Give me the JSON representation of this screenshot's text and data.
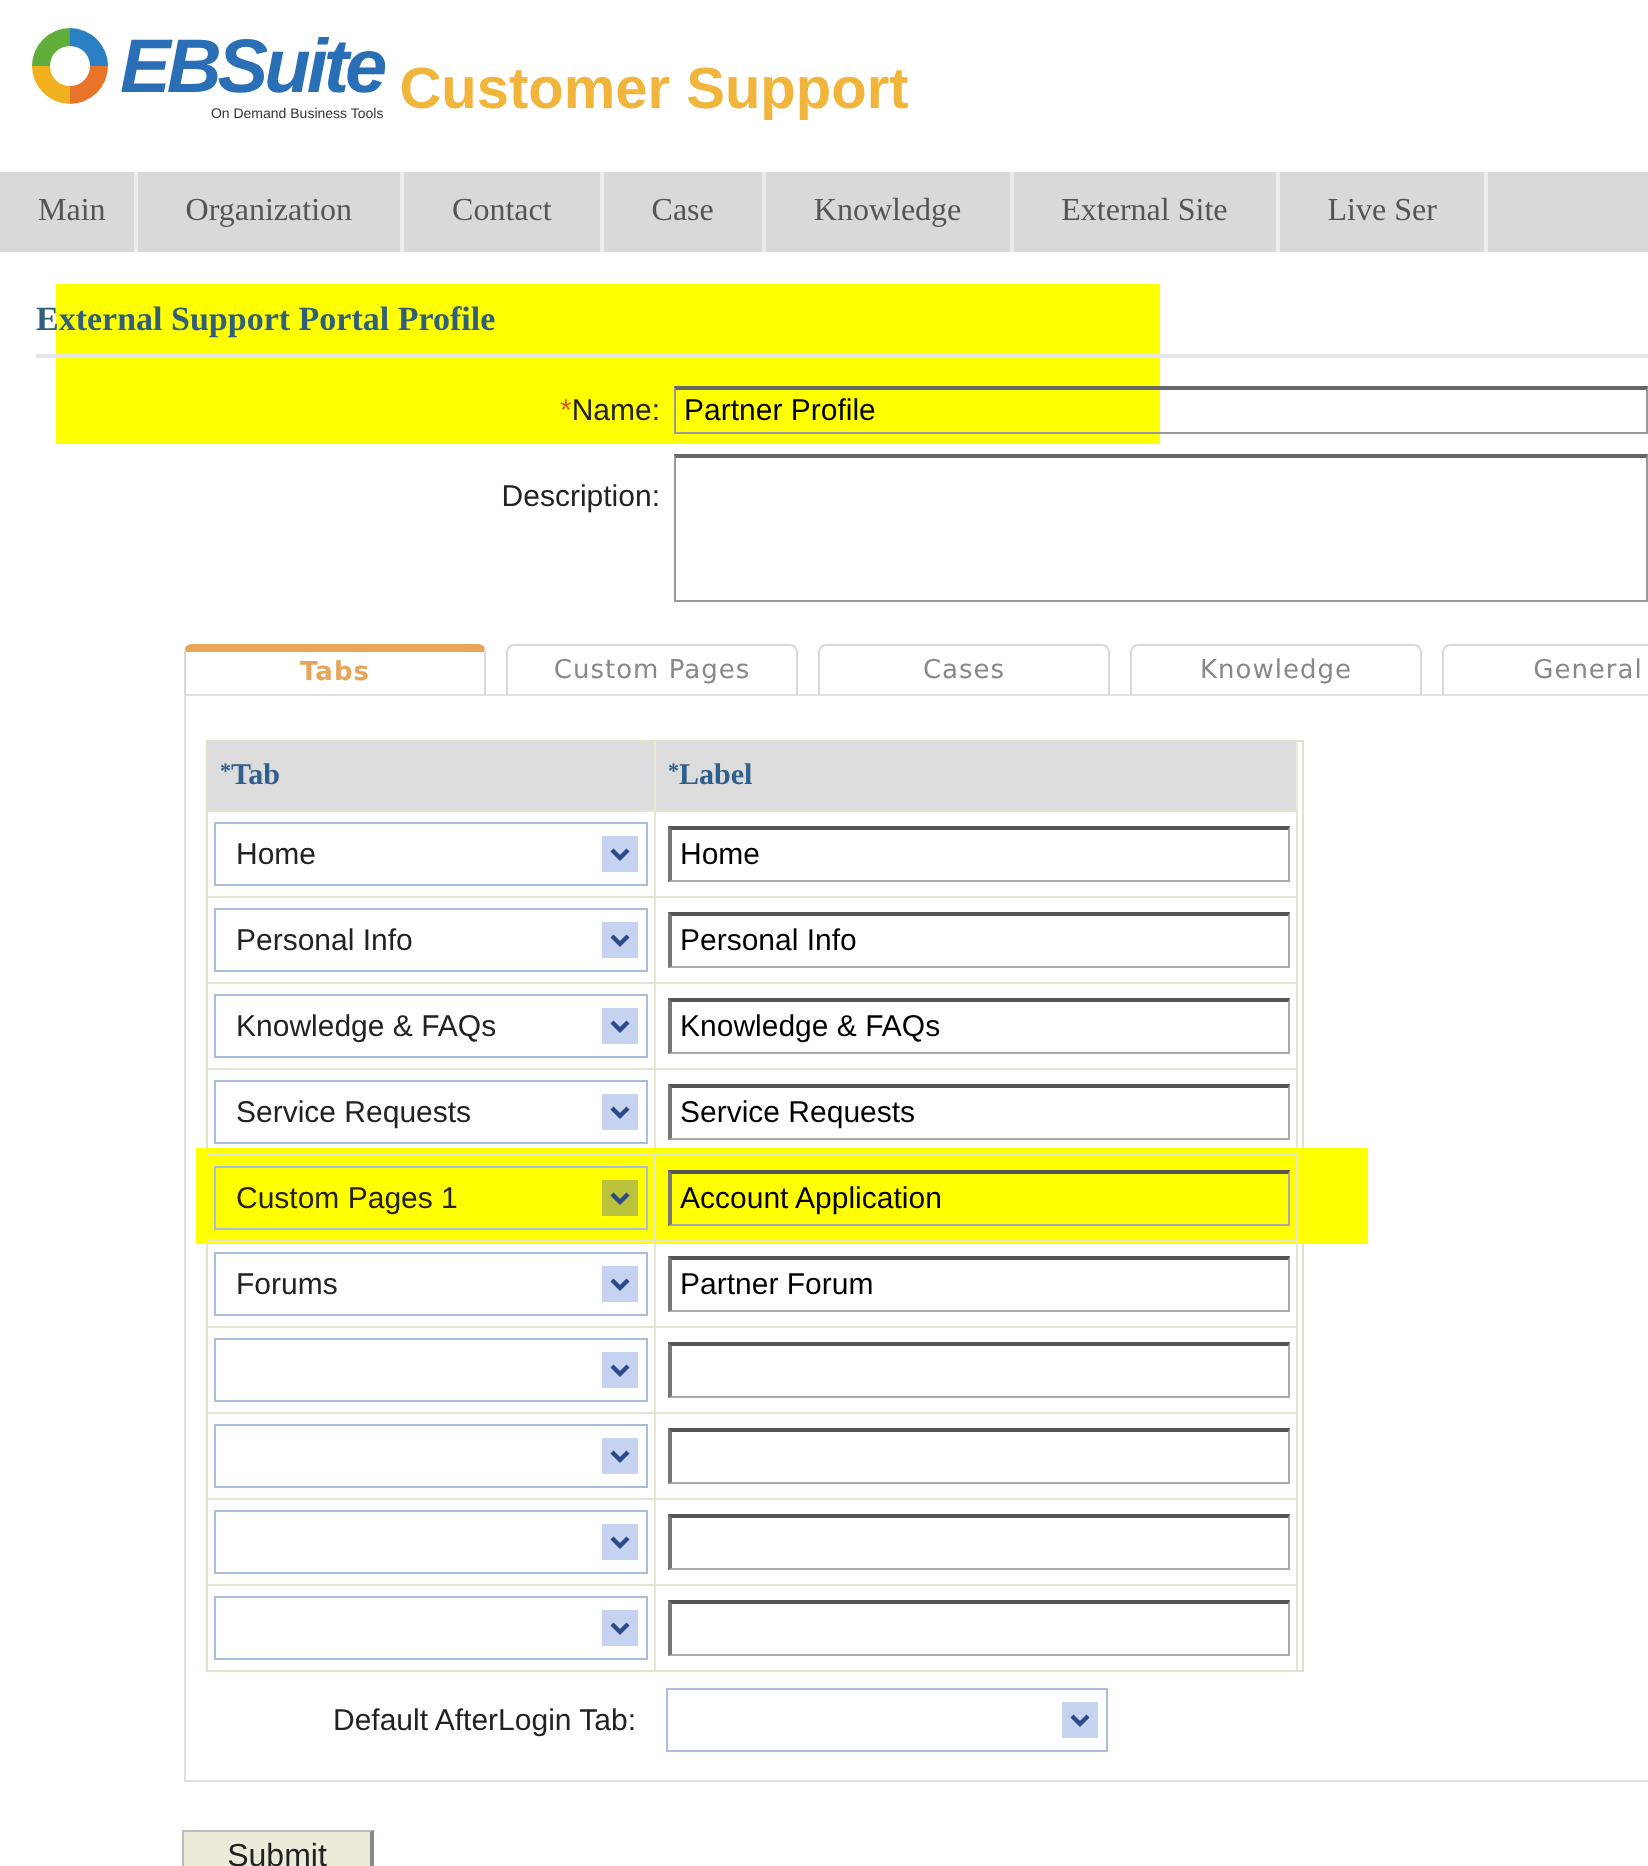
{
  "logo": {
    "brand": "EBSuite",
    "tagline": "On Demand Business Tools"
  },
  "app_title": "Customer Support",
  "nav": [
    {
      "label": "Main"
    },
    {
      "label": "Organization"
    },
    {
      "label": "Contact"
    },
    {
      "label": "Case"
    },
    {
      "label": "Knowledge"
    },
    {
      "label": "External Site"
    },
    {
      "label": "Live Ser"
    }
  ],
  "heading": "External Support Portal Profile",
  "heading_highlighted": true,
  "name_field": {
    "label": "Name:",
    "required_mark": "*",
    "value": "Partner Profile"
  },
  "description_field": {
    "label": "Description:"
  },
  "tabs": [
    {
      "label": "Tabs",
      "selected": true
    },
    {
      "label": "Custom Pages",
      "selected": false
    },
    {
      "label": "Cases",
      "selected": false
    },
    {
      "label": "Knowledge",
      "selected": false
    },
    {
      "label": "General",
      "selected": false
    }
  ],
  "table": {
    "columns": [
      {
        "required_mark": "*",
        "label": "Tab"
      },
      {
        "required_mark": "*",
        "label": "Label"
      }
    ],
    "rows": [
      {
        "tab": "Home",
        "label": "Home",
        "highlighted": false
      },
      {
        "tab": "Personal Info",
        "label": "Personal Info",
        "highlighted": false
      },
      {
        "tab": "Knowledge & FAQs",
        "label": "Knowledge & FAQs",
        "highlighted": false
      },
      {
        "tab": "Service Requests",
        "label": "Service Requests",
        "highlighted": false
      },
      {
        "tab": "Custom Pages 1",
        "label": "Account Application",
        "highlighted": true
      },
      {
        "tab": "Forums",
        "label": "Partner Forum",
        "highlighted": false
      },
      {
        "highlighted": false
      },
      {
        "highlighted": false
      },
      {
        "highlighted": false
      },
      {
        "highlighted": false
      }
    ]
  },
  "default_tab": {
    "label": "Default AfterLogin Tab:"
  },
  "submit": "Submit"
}
